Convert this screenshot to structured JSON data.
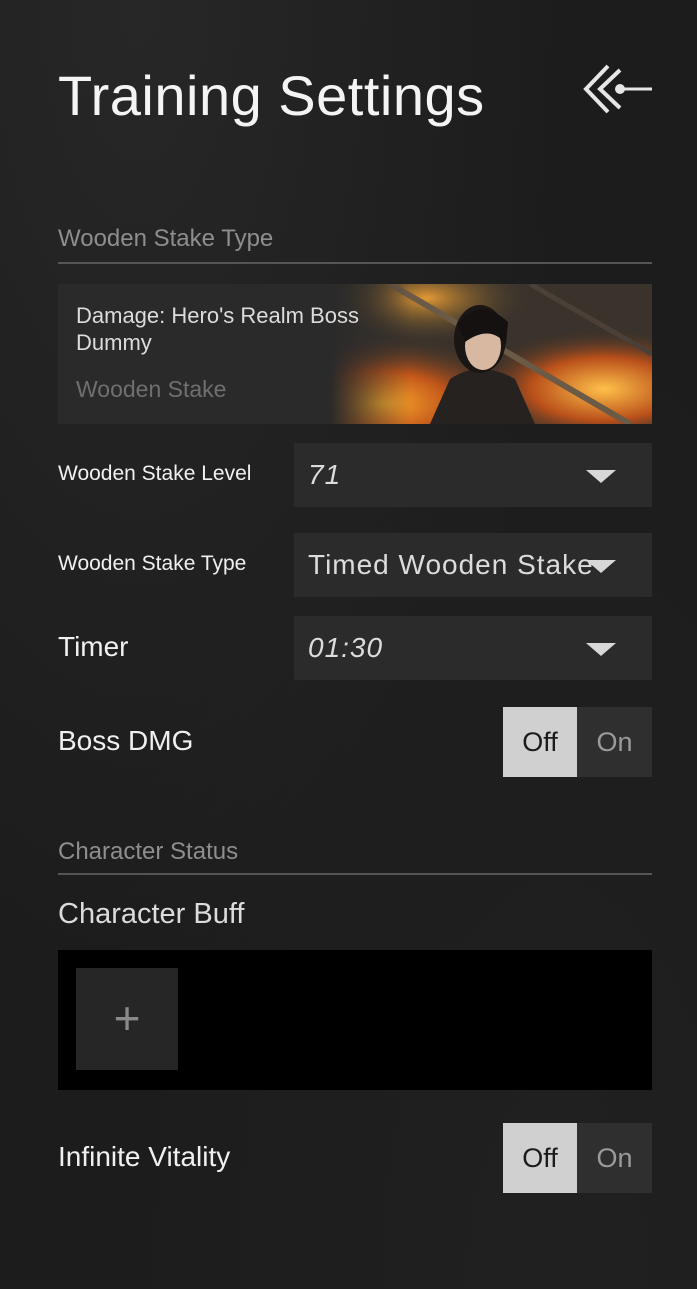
{
  "header": {
    "title": "Training Settings",
    "back_icon": "back-arrow-icon"
  },
  "stake_section": {
    "label": "Wooden Stake Type",
    "card": {
      "title": "Damage: Hero's Realm Boss Dummy",
      "subtitle": "Wooden Stake"
    }
  },
  "settings": {
    "level": {
      "label": "Wooden Stake Level",
      "value": "71"
    },
    "type": {
      "label": "Wooden Stake Type",
      "value": "Timed Wooden Stake"
    },
    "timer": {
      "label": "Timer",
      "value": "01:30"
    },
    "boss_dmg": {
      "label": "Boss DMG",
      "off": "Off",
      "on": "On",
      "selected": "Off"
    }
  },
  "character_section": {
    "label": "Character Status",
    "buff_label": "Character Buff",
    "add_icon": "plus-icon",
    "infinite_vitality": {
      "label": "Infinite Vitality",
      "off": "Off",
      "on": "On",
      "selected": "Off"
    }
  },
  "colors": {
    "background": "#1c1c1c",
    "select_bg": "#2b2b2b",
    "toggle_selected": "#d0d0d0",
    "divider": "#555555"
  }
}
